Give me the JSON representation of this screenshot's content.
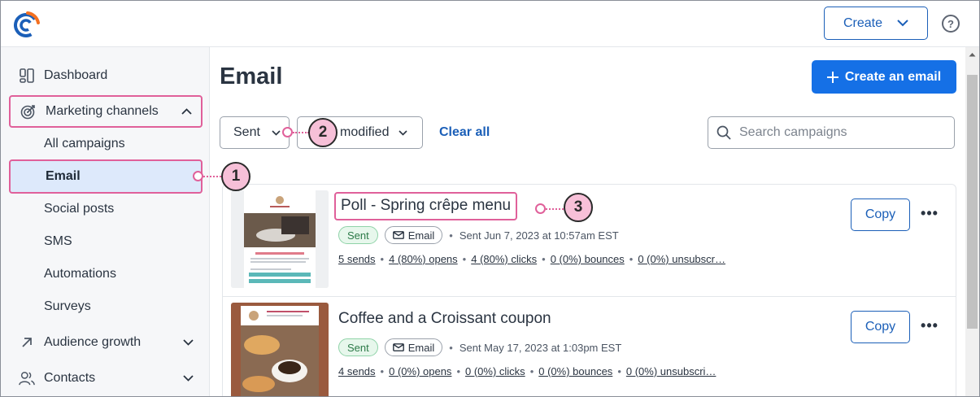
{
  "topbar": {
    "create_label": "Create",
    "help_glyph": "?"
  },
  "sidebar": {
    "items": [
      {
        "label": "Dashboard",
        "icon": "dashboard-icon"
      },
      {
        "label": "Marketing channels",
        "icon": "target-icon"
      },
      {
        "label": "All campaigns"
      },
      {
        "label": "Email"
      },
      {
        "label": "Social posts"
      },
      {
        "label": "SMS"
      },
      {
        "label": "Automations"
      },
      {
        "label": "Surveys"
      },
      {
        "label": "Audience growth",
        "icon": "arrow-up-right-icon"
      },
      {
        "label": "Contacts",
        "icon": "contacts-icon"
      }
    ]
  },
  "main": {
    "title": "Email",
    "create_email_label": "Create an email",
    "filters": {
      "status_value": "Sent",
      "sort_value": "modified",
      "clear_all_label": "Clear all"
    },
    "search": {
      "placeholder": "Search campaigns",
      "value": ""
    },
    "campaigns": [
      {
        "title": "Poll - Spring crêpe menu",
        "status": "Sent",
        "type": "Email",
        "sent_date": "Sent Jun 7, 2023 at 10:57am EST",
        "stats": [
          "5 sends",
          "4 (80%) opens",
          "4 (80%) clicks",
          "0 (0%) bounces",
          "0 (0%) unsubscr…"
        ],
        "copy_label": "Copy",
        "more_label": "•••"
      },
      {
        "title": "Coffee and a Croissant coupon",
        "status": "Sent",
        "type": "Email",
        "sent_date": "Sent May 17, 2023 at 1:03pm EST",
        "stats": [
          "4 sends",
          "0 (0%) opens",
          "0 (0%) clicks",
          "0 (0%) bounces",
          "0 (0%) unsubscri…"
        ],
        "copy_label": "Copy",
        "more_label": "•••"
      }
    ]
  },
  "callouts": [
    "1",
    "2",
    "3"
  ],
  "colors": {
    "accent": "#1570e6",
    "link": "#1b5fb8",
    "highlight": "#e0609a",
    "callout_fill": "#f7c0d8",
    "active_nav": "#dde9fb"
  }
}
